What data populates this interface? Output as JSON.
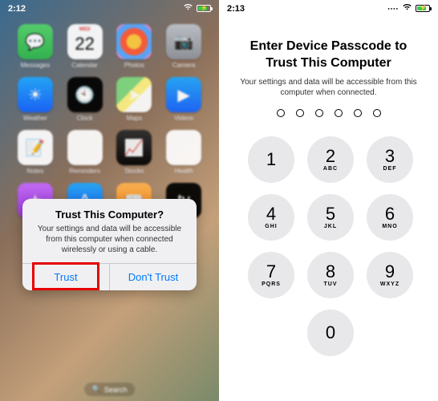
{
  "left": {
    "status_time": "2:12",
    "apps": [
      {
        "label": "Messages",
        "bg": "bg-green",
        "glyph": "💬"
      },
      {
        "label": "Calendar",
        "bg": "bg-white",
        "wed": "WED",
        "day": "22"
      },
      {
        "label": "Photos",
        "bg": "bg-multi",
        "glyph": ""
      },
      {
        "label": "Camera",
        "bg": "bg-gray",
        "glyph": "📷"
      },
      {
        "label": "Weather",
        "bg": "bg-appstore",
        "glyph": "☀"
      },
      {
        "label": "Clock",
        "bg": "bg-black",
        "glyph": "🕙"
      },
      {
        "label": "Maps",
        "bg": "bg-maps",
        "glyph": "➤"
      },
      {
        "label": "Videos",
        "bg": "bg-appstore",
        "glyph": "▶"
      },
      {
        "label": "Notes",
        "bg": "bg-white",
        "glyph": "📝"
      },
      {
        "label": "Reminders",
        "bg": "bg-white",
        "glyph": "☰"
      },
      {
        "label": "Stocks",
        "bg": "bg-dark",
        "glyph": "📈"
      },
      {
        "label": "Health",
        "bg": "bg-health",
        "glyph": "♥"
      },
      {
        "label": "iTunes",
        "bg": "bg-itunes",
        "glyph": "★"
      },
      {
        "label": "App Store",
        "bg": "bg-appstore",
        "glyph": "A"
      },
      {
        "label": "iBooks",
        "bg": "bg-orange",
        "glyph": "📖"
      },
      {
        "label": "Apple TV",
        "bg": "bg-black",
        "glyph": "tv"
      }
    ],
    "dialog": {
      "title": "Trust This Computer?",
      "message": "Your settings and data will be accessible from this computer when connected wirelessly or using a cable.",
      "trust": "Trust",
      "dont_trust": "Don't Trust"
    },
    "search_label": "Search"
  },
  "right": {
    "status_time": "2:13",
    "title": "Enter Device Passcode to Trust This Computer",
    "subtitle": "Your settings and data will be accessible from this computer when connected.",
    "passcode_length": 6,
    "keys": [
      {
        "num": "1",
        "letters": ""
      },
      {
        "num": "2",
        "letters": "ABC"
      },
      {
        "num": "3",
        "letters": "DEF"
      },
      {
        "num": "4",
        "letters": "GHI"
      },
      {
        "num": "5",
        "letters": "JKL"
      },
      {
        "num": "6",
        "letters": "MNO"
      },
      {
        "num": "7",
        "letters": "PQRS"
      },
      {
        "num": "8",
        "letters": "TUV"
      },
      {
        "num": "9",
        "letters": "WXYZ"
      },
      {
        "num": "",
        "letters": "",
        "empty": true
      },
      {
        "num": "0",
        "letters": ""
      },
      {
        "num": "",
        "letters": "",
        "empty": true
      }
    ]
  }
}
